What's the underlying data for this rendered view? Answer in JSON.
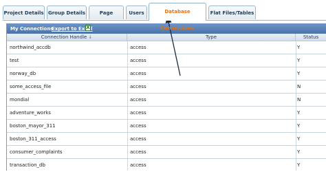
{
  "tabs": [
    {
      "label": "Project Details",
      "active": false
    },
    {
      "label": "Group Details",
      "active": false
    },
    {
      "label": "Page Details",
      "active": false
    },
    {
      "label": "Users",
      "active": false
    },
    {
      "label": "Database Connections",
      "active": true
    },
    {
      "label": "Flat Files/Tables",
      "active": false
    }
  ],
  "panel": {
    "title": "My Connections",
    "export_label": "Export to Excel",
    "excel_glyph": "X"
  },
  "columns": {
    "handle": "Connection Handle",
    "sort_glyph": "↓",
    "type": "Type",
    "status": "Status"
  },
  "rows": [
    {
      "handle": "northwind_accdb",
      "type": "access",
      "status": "Y"
    },
    {
      "handle": "test",
      "type": "access",
      "status": "Y"
    },
    {
      "handle": "norway_db",
      "type": "access",
      "status": "Y"
    },
    {
      "handle": "some_access_file",
      "type": "access",
      "status": "N"
    },
    {
      "handle": "mondial",
      "type": "access",
      "status": "N"
    },
    {
      "handle": "adventure_works",
      "type": "access",
      "status": "Y"
    },
    {
      "handle": "boston_mayor_311",
      "type": "access",
      "status": "Y"
    },
    {
      "handle": "boston_311_access",
      "type": "access",
      "status": "Y"
    },
    {
      "handle": "consumer_complaints",
      "type": "access",
      "status": "Y"
    },
    {
      "handle": "transaction_db",
      "type": "access",
      "status": "Y"
    }
  ],
  "colors": {
    "header_bg": "#4a73a9",
    "active_tab_text": "#e2731a",
    "tab_text": "#1f3c58"
  }
}
